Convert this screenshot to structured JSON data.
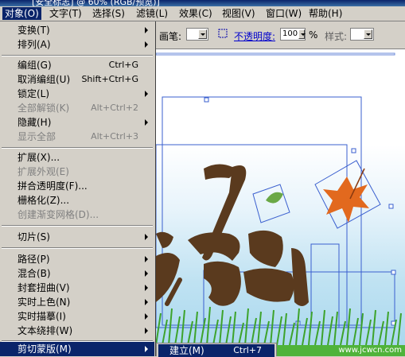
{
  "window": {
    "title": "[安全标志] @ 60% (RGB/预览)]"
  },
  "menubar": {
    "items": [
      {
        "label": "对象(O)",
        "active": true
      },
      {
        "label": "文字(T)"
      },
      {
        "label": "选择(S)"
      },
      {
        "label": "滤镜(L)"
      },
      {
        "label": "效果(C)"
      },
      {
        "label": "视图(V)"
      },
      {
        "label": "窗口(W)"
      },
      {
        "label": "帮助(H)"
      }
    ]
  },
  "controlbar": {
    "brush_label": "画笔:",
    "opacity_label": "不透明度:",
    "opacity_value": "100",
    "opacity_unit": "%",
    "style_label": "样式:"
  },
  "object_menu": {
    "items": [
      {
        "label": "变换(T)",
        "submenu": true
      },
      {
        "label": "排列(A)",
        "submenu": true
      },
      {
        "label": "编组(G)",
        "shortcut": "Ctrl+G"
      },
      {
        "label": "取消编组(U)",
        "shortcut": "Shift+Ctrl+G"
      },
      {
        "label": "锁定(L)",
        "submenu": true
      },
      {
        "label": "全部解锁(K)",
        "shortcut": "Alt+Ctrl+2",
        "disabled": true
      },
      {
        "label": "隐藏(H)",
        "submenu": true
      },
      {
        "label": "显示全部",
        "shortcut": "Alt+Ctrl+3",
        "disabled": true
      },
      {
        "label": "扩展(X)..."
      },
      {
        "label": "扩展外观(E)",
        "disabled": true
      },
      {
        "label": "拼合透明度(F)..."
      },
      {
        "label": "栅格化(Z)..."
      },
      {
        "label": "创建渐变网格(D)...",
        "disabled": true
      },
      {
        "label": "切片(S)",
        "submenu": true
      },
      {
        "label": "路径(P)",
        "submenu": true
      },
      {
        "label": "混合(B)",
        "submenu": true
      },
      {
        "label": "封套扭曲(V)",
        "submenu": true
      },
      {
        "label": "实时上色(N)",
        "submenu": true
      },
      {
        "label": "实时描摹(I)",
        "submenu": true
      },
      {
        "label": "文本绕排(W)",
        "submenu": true
      },
      {
        "label": "剪切蒙版(M)",
        "submenu": true,
        "selected": true
      }
    ]
  },
  "clipping_submenu": {
    "items": [
      {
        "label": "建立(M)",
        "shortcut": "Ctrl+7",
        "selected": true
      }
    ]
  },
  "canvas": {
    "artwork_text": "秋风",
    "watermark_text": "www.jcwcn.com",
    "colors": {
      "text": "#5a3a1e",
      "grass": "#3da32b",
      "leaf_orange": "#e2691e",
      "leaf_green": "#6aa846",
      "selection": "#3a5fcf"
    }
  }
}
